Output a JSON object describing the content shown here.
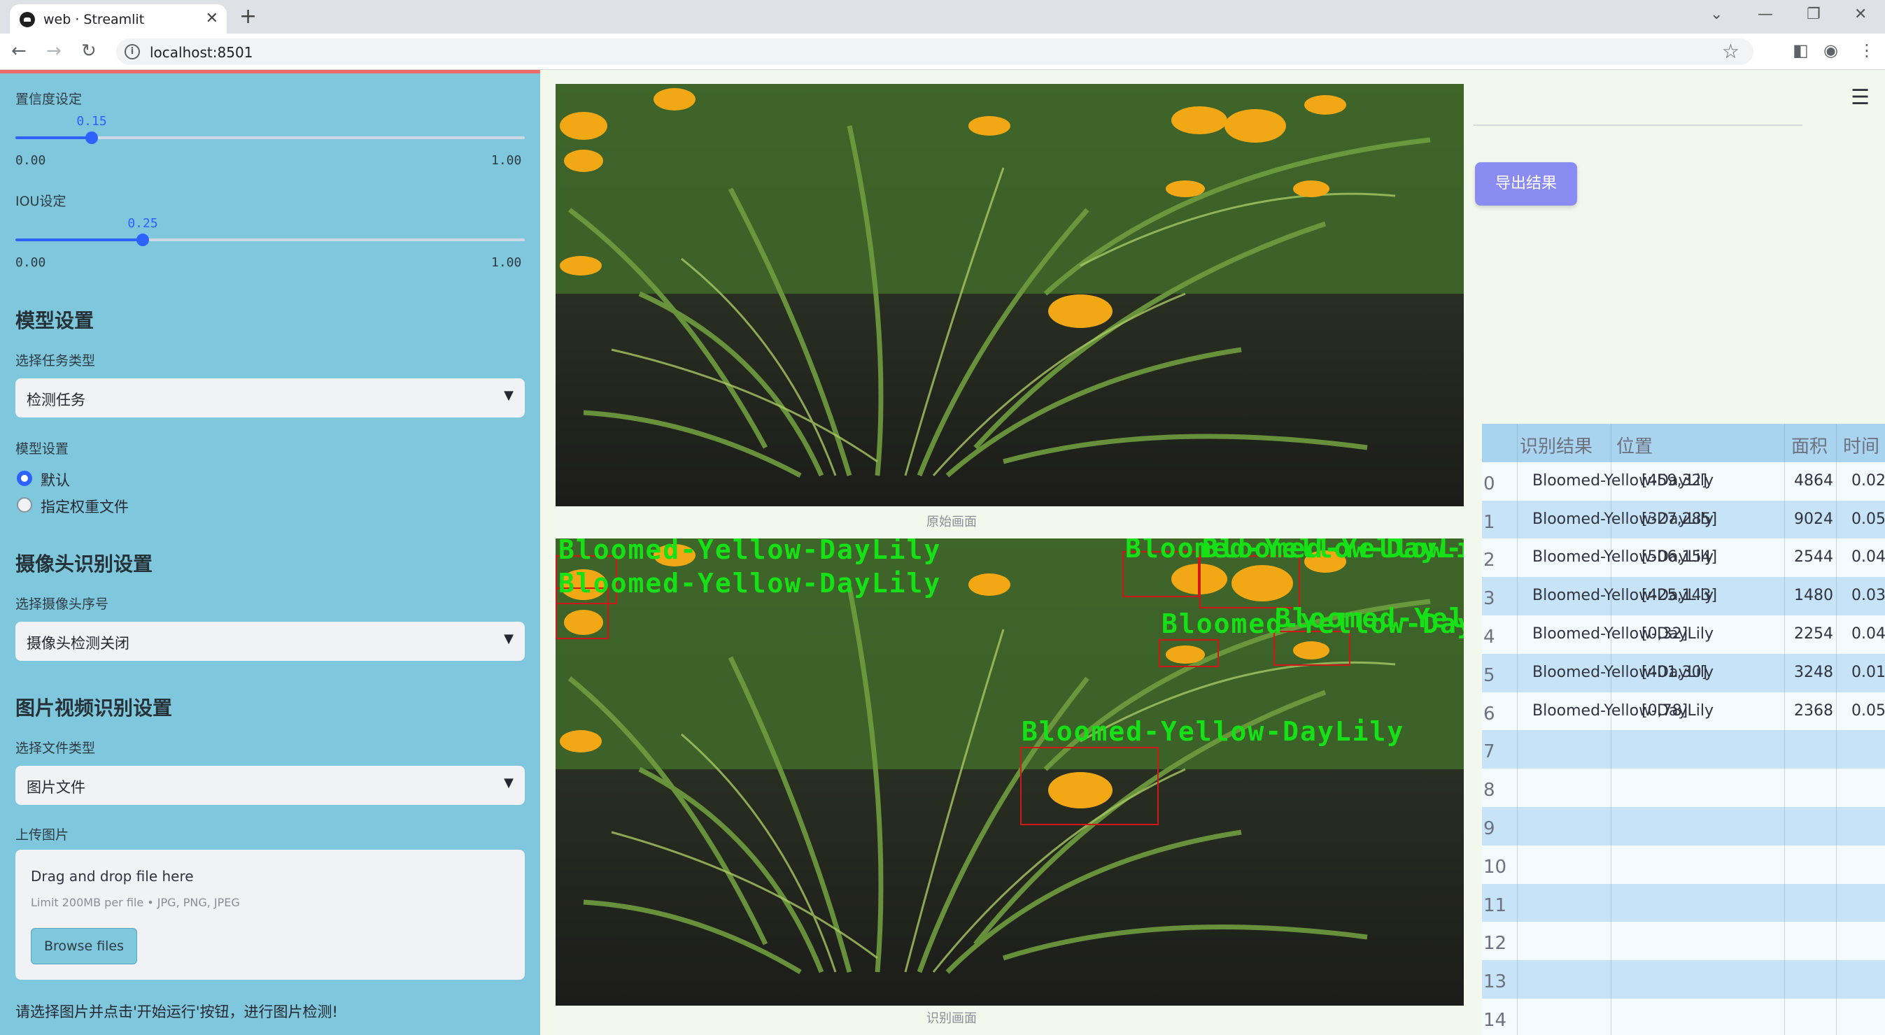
{
  "browser": {
    "tab_title": "web · Streamlit",
    "url": "localhost:8501"
  },
  "sidebar": {
    "confidence": {
      "label": "置信度设定",
      "value": "0.15",
      "min": "0.00",
      "max": "1.00",
      "level": 0.15
    },
    "iou": {
      "label": "IOU设定",
      "value": "0.25",
      "min": "0.00",
      "max": "1.00",
      "level": 0.25
    },
    "model_heading": "模型设置",
    "task_label": "选择任务类型",
    "task_value": "检测任务",
    "model_label": "模型设置",
    "model_options": [
      "默认",
      "指定权重文件"
    ],
    "camera_heading": "摄像头识别设置",
    "camera_label": "选择摄像头序号",
    "camera_value": "摄像头检测关闭",
    "media_heading": "图片视频识别设置",
    "filetype_label": "选择文件类型",
    "filetype_value": "图片文件",
    "upload_label": "上传图片",
    "upload_title": "Drag and drop file here",
    "upload_limit": "Limit 200MB per file • JPG, PNG, JPEG",
    "browse_label": "Browse files",
    "hint": "请选择图片并点击'开始运行'按钮，进行图片检测!"
  },
  "main": {
    "original_caption": "原始画面",
    "result_caption": "识别画面",
    "export_label": "导出结果",
    "detections": [
      "Bloomed-Yellow-DayLily",
      "Bloomed-Yellow-DayLily",
      "Bloomed-Yellow-DayLily",
      "Bloomed-Yellow-DayLily",
      "Bloomed-Yellow-DayLily",
      "Bloomed-Yellow-DayLily",
      "Bloomed-Yellow-DayLily"
    ]
  },
  "table": {
    "headers": [
      "识别结果",
      "位置",
      "面积",
      "时间"
    ],
    "rows": [
      {
        "index": "0",
        "result": "Bloomed-Yellow-DayLily",
        "position": "[459,32]",
        "area": "4864",
        "time": "0.02"
      },
      {
        "index": "1",
        "result": "Bloomed-Yellow-DayLily",
        "position": "[327,285]",
        "area": "9024",
        "time": "0.05"
      },
      {
        "index": "2",
        "result": "Bloomed-Yellow-DayLily",
        "position": "[506,154]",
        "area": "2544",
        "time": "0.04"
      },
      {
        "index": "3",
        "result": "Bloomed-Yellow-DayLily",
        "position": "[425,143]",
        "area": "1480",
        "time": "0.03"
      },
      {
        "index": "4",
        "result": "Bloomed-Yellow-DayLily",
        "position": "[0,32]",
        "area": "2254",
        "time": "0.04"
      },
      {
        "index": "5",
        "result": "Bloomed-Yellow-DayLily",
        "position": "[401,30]",
        "area": "3248",
        "time": "0.01"
      },
      {
        "index": "6",
        "result": "Bloomed-Yellow-DayLily",
        "position": "[0,78]",
        "area": "2368",
        "time": "0.05"
      }
    ],
    "empty_indices": [
      "7",
      "8",
      "9",
      "10",
      "11",
      "12",
      "13",
      "14"
    ]
  }
}
